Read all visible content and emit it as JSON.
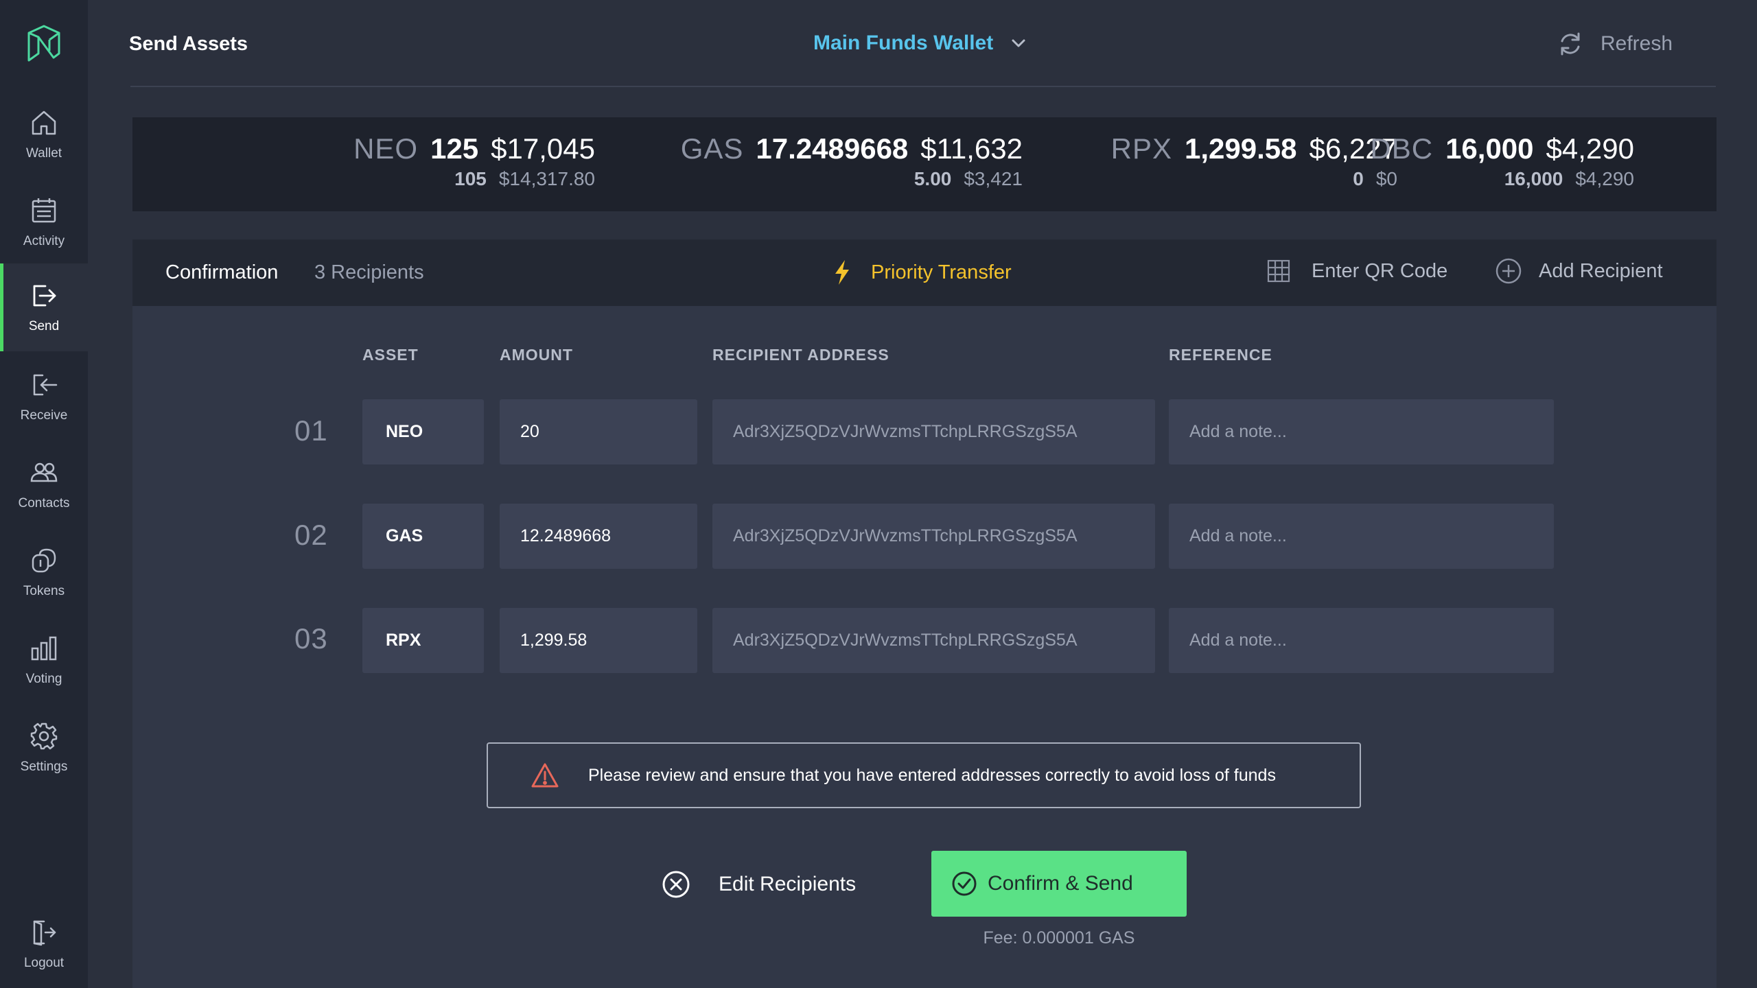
{
  "header": {
    "title": "Send Assets",
    "wallet": "Main Funds Wallet",
    "refresh_label": "Refresh"
  },
  "sidebar": {
    "items": [
      {
        "label": "Wallet",
        "icon": "home-icon"
      },
      {
        "label": "Activity",
        "icon": "calendar-icon"
      },
      {
        "label": "Send",
        "icon": "send-icon",
        "active": true
      },
      {
        "label": "Receive",
        "icon": "receive-icon"
      },
      {
        "label": "Contacts",
        "icon": "contacts-icon"
      },
      {
        "label": "Tokens",
        "icon": "tokens-icon"
      },
      {
        "label": "Voting",
        "icon": "bar-chart-icon"
      },
      {
        "label": "Settings",
        "icon": "gear-icon"
      }
    ],
    "logout_label": "Logout"
  },
  "balances": [
    {
      "symbol": "NEO",
      "amount": "125",
      "usd": "$17,045",
      "sub_amount": "105",
      "sub_usd": "$14,317.80"
    },
    {
      "symbol": "GAS",
      "amount": "17.2489668",
      "usd": "$11,632",
      "sub_amount": "5.00",
      "sub_usd": "$3,421"
    },
    {
      "symbol": "RPX",
      "amount": "1,299.58",
      "usd": "$6,227",
      "sub_amount": "0",
      "sub_usd": "$0"
    },
    {
      "symbol": "DBC",
      "amount": "16,000",
      "usd": "$4,290",
      "sub_amount": "16,000",
      "sub_usd": "$4,290"
    }
  ],
  "panel": {
    "tab_label": "Confirmation",
    "recipient_count": "3 Recipients",
    "priority_label": "Priority Transfer",
    "qr_label": "Enter QR Code",
    "add_recipient_label": "Add Recipient"
  },
  "table": {
    "headers": {
      "asset": "ASSET",
      "amount": "AMOUNT",
      "address": "RECIPIENT ADDRESS",
      "reference": "REFERENCE"
    },
    "rows": [
      {
        "num": "01",
        "asset": "NEO",
        "amount": "20",
        "address": "Adr3XjZ5QDzVJrWvzmsTTchpLRRGSzgS5A",
        "note_placeholder": "Add a note..."
      },
      {
        "num": "02",
        "asset": "GAS",
        "amount": "12.2489668",
        "address": "Adr3XjZ5QDzVJrWvzmsTTchpLRRGSzgS5A",
        "note_placeholder": "Add a note..."
      },
      {
        "num": "03",
        "asset": "RPX",
        "amount": "1,299.58",
        "address": "Adr3XjZ5QDzVJrWvzmsTTchpLRRGSzgS5A",
        "note_placeholder": "Add a note..."
      }
    ]
  },
  "warning": "Please review and ensure that you have entered addresses correctly to avoid loss of funds",
  "actions": {
    "edit_label": "Edit Recipients",
    "confirm_label": "Confirm & Send",
    "fee": "Fee: 0.000001 GAS"
  },
  "colors": {
    "accent_green": "#5ae186",
    "wallet_blue": "#58c4ec",
    "priority_yellow": "#f5c32c",
    "warning_red": "#e8685a"
  }
}
